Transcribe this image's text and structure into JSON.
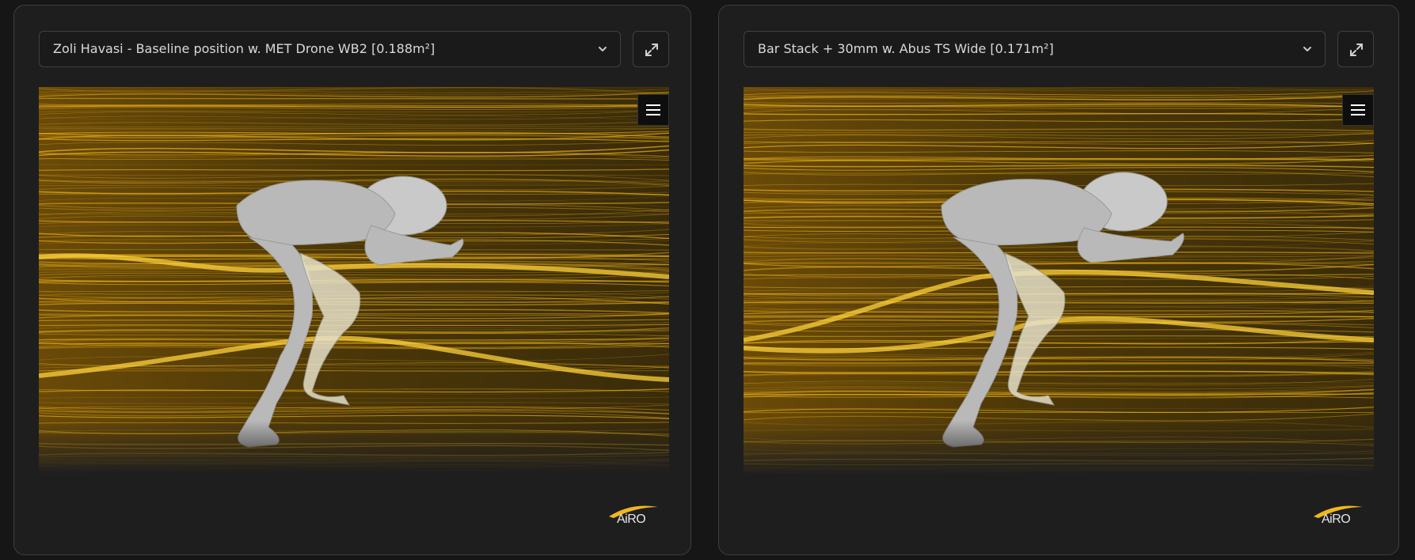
{
  "panels": [
    {
      "selected_option": "Zoli Havasi - Baseline position w. MET Drone WB2 [0.188m²]",
      "logo_text": "AiRO"
    },
    {
      "selected_option": "Bar Stack + 30mm w. Abus TS Wide [0.171m²]",
      "logo_text": "AiRO"
    }
  ],
  "colors": {
    "accent": "#f2b71a",
    "panel_bg": "#1e1e1f",
    "page_bg": "#161616",
    "figure": "#b9b9b9"
  },
  "icons": {
    "dropdown": "chevron-down-icon",
    "expand": "expand-arrows-icon",
    "menu": "hamburger-menu-icon"
  }
}
